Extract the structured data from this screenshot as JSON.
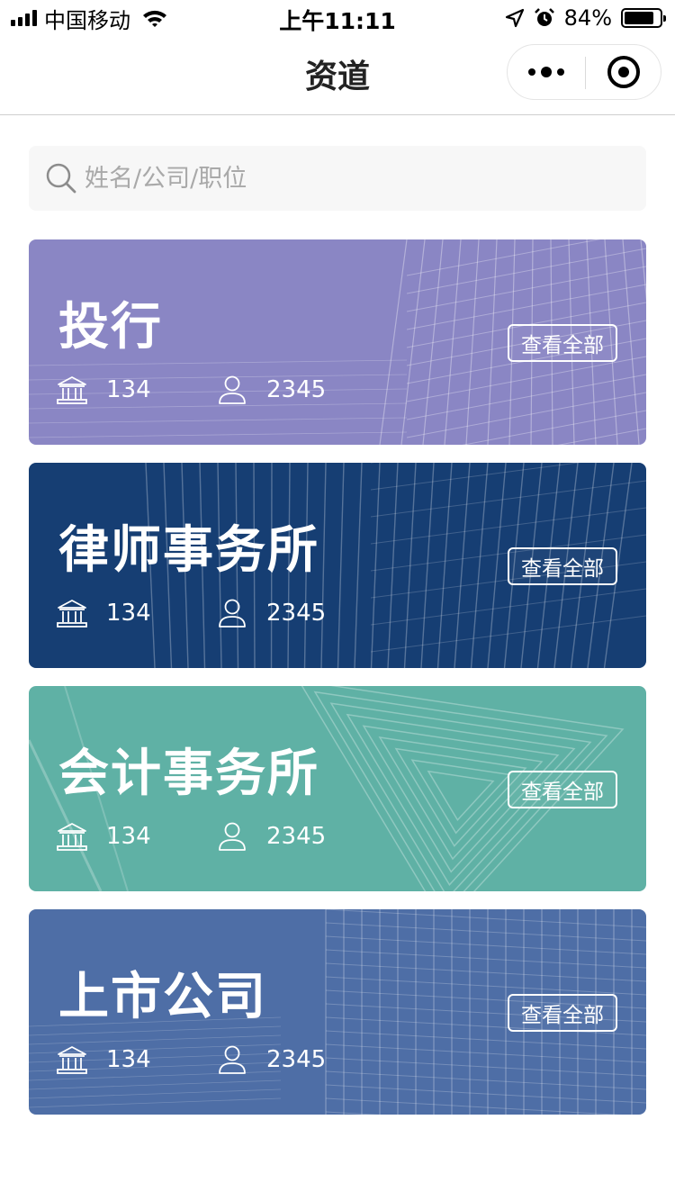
{
  "status_bar": {
    "carrier": "中国移动",
    "time": "上午11:11",
    "battery": "84%",
    "battery_level": 0.84,
    "icons": [
      "signal-icon",
      "wifi-icon",
      "location-icon",
      "alarm-icon",
      "battery-icon"
    ]
  },
  "nav": {
    "title": "资道",
    "more_icon": "more-icon",
    "close_icon": "target-icon"
  },
  "search": {
    "placeholder": "姓名/公司/职位",
    "value": "",
    "icon": "search-icon"
  },
  "cards": [
    {
      "title": "投行",
      "button": "查看全部",
      "org_count": "134",
      "people_count": "2345",
      "color": "#8a86c4"
    },
    {
      "title": "律师事务所",
      "button": "查看全部",
      "org_count": "134",
      "people_count": "2345",
      "color": "#163e73"
    },
    {
      "title": "会计事务所",
      "button": "查看全部",
      "org_count": "134",
      "people_count": "2345",
      "color": "#5fb1a5"
    },
    {
      "title": "上市公司",
      "button": "查看全部",
      "org_count": "134",
      "people_count": "2345",
      "color": "#4e6ea6"
    }
  ],
  "stat_icons": [
    "bank-icon",
    "person-icon"
  ]
}
